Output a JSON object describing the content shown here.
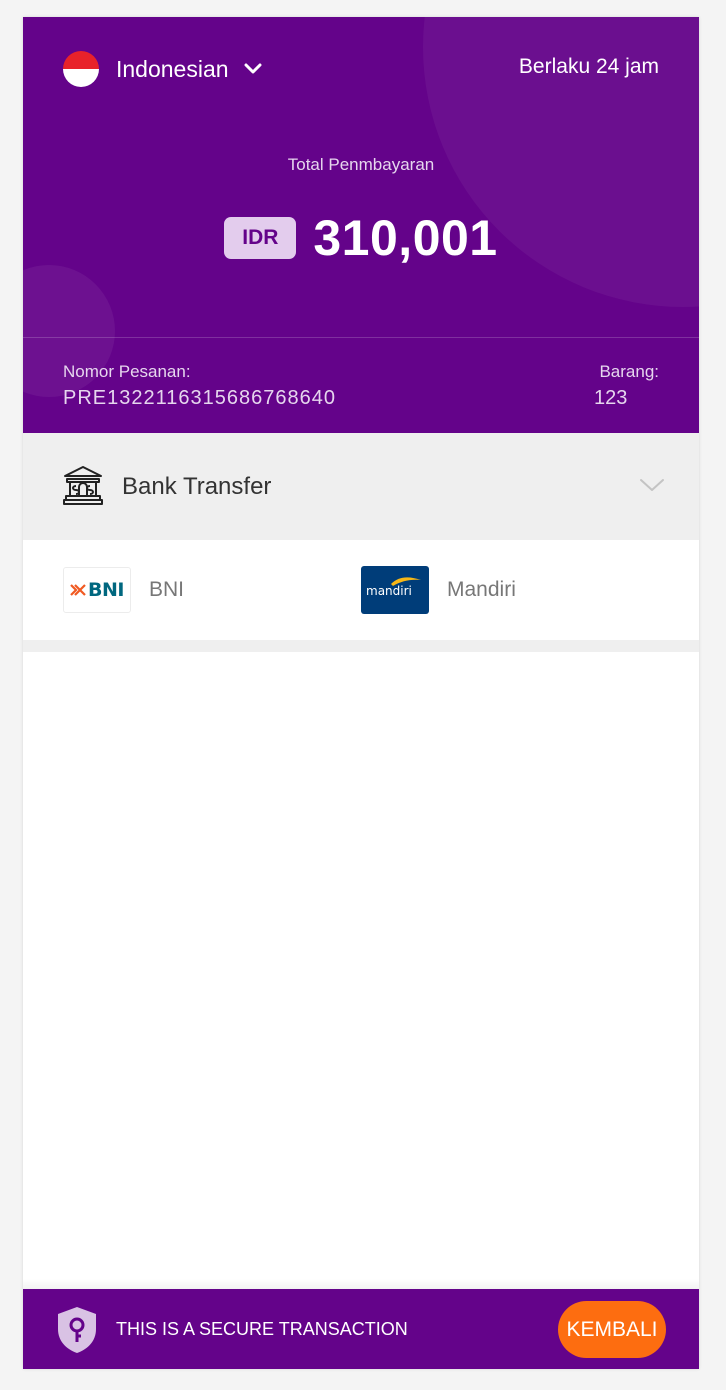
{
  "header": {
    "language": "Indonesian",
    "validity": "Berlaku 24 jam",
    "total_label": "Total Penmbayaran",
    "currency": "IDR",
    "amount": "310,001",
    "order_label": "Nomor Pesanan:",
    "order_number": "PRE1322116315686768640",
    "items_label": "Barang:",
    "items_value": "123"
  },
  "payment_method": {
    "label": "Bank Transfer",
    "icon": "bank-icon",
    "expanded_icon": "chevron-down-icon"
  },
  "banks": [
    {
      "name": "BNI",
      "logo_text": "BNI"
    },
    {
      "name": "Mandiri",
      "logo_text": "mandiri"
    }
  ],
  "footer": {
    "secure_text": "THIS IS A SECURE TRANSACTION",
    "back_label": "KEMBALI"
  },
  "colors": {
    "brand_purple": "#64038a",
    "accent_orange": "#fd6d10",
    "badge_bg": "#e3cced",
    "section_gray": "#efefef"
  }
}
